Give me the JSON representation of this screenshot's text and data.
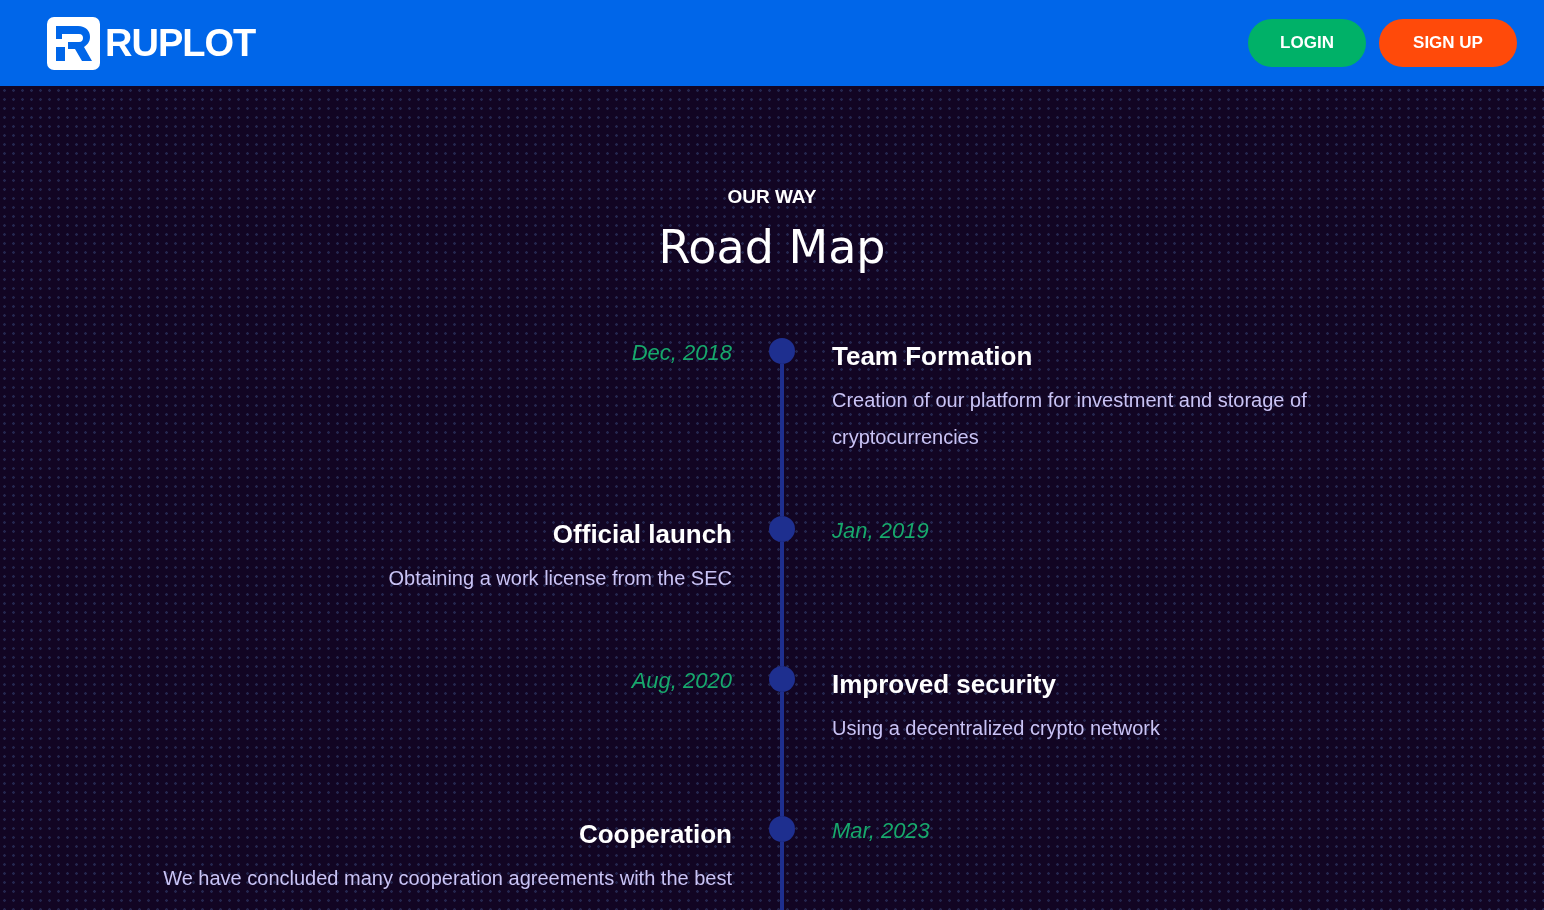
{
  "header": {
    "logo_text": "RUPLOT",
    "buttons": [
      {
        "label": "LOGIN",
        "kind": "login"
      },
      {
        "label": "SIGN UP",
        "kind": "signup"
      }
    ]
  },
  "section": {
    "eyebrow": "OUR WAY",
    "title": "Road Map"
  },
  "timeline": [
    {
      "date": "Dec, 2018",
      "title": "Team Formation",
      "description": "Creation of our platform for investment and storage of cryptocurrencies",
      "kind": "right"
    },
    {
      "date": "Jan, 2019",
      "title": "Official launch",
      "description": "Obtaining a work license from the SEC",
      "kind": "left"
    },
    {
      "date": "Aug, 2020",
      "title": "Improved security",
      "description": "Using a decentralized crypto network",
      "kind": "right"
    },
    {
      "date": "Mar, 2023",
      "title": "Cooperation",
      "description": "We have concluded many cooperation agreements with the best",
      "kind": "left"
    }
  ]
}
